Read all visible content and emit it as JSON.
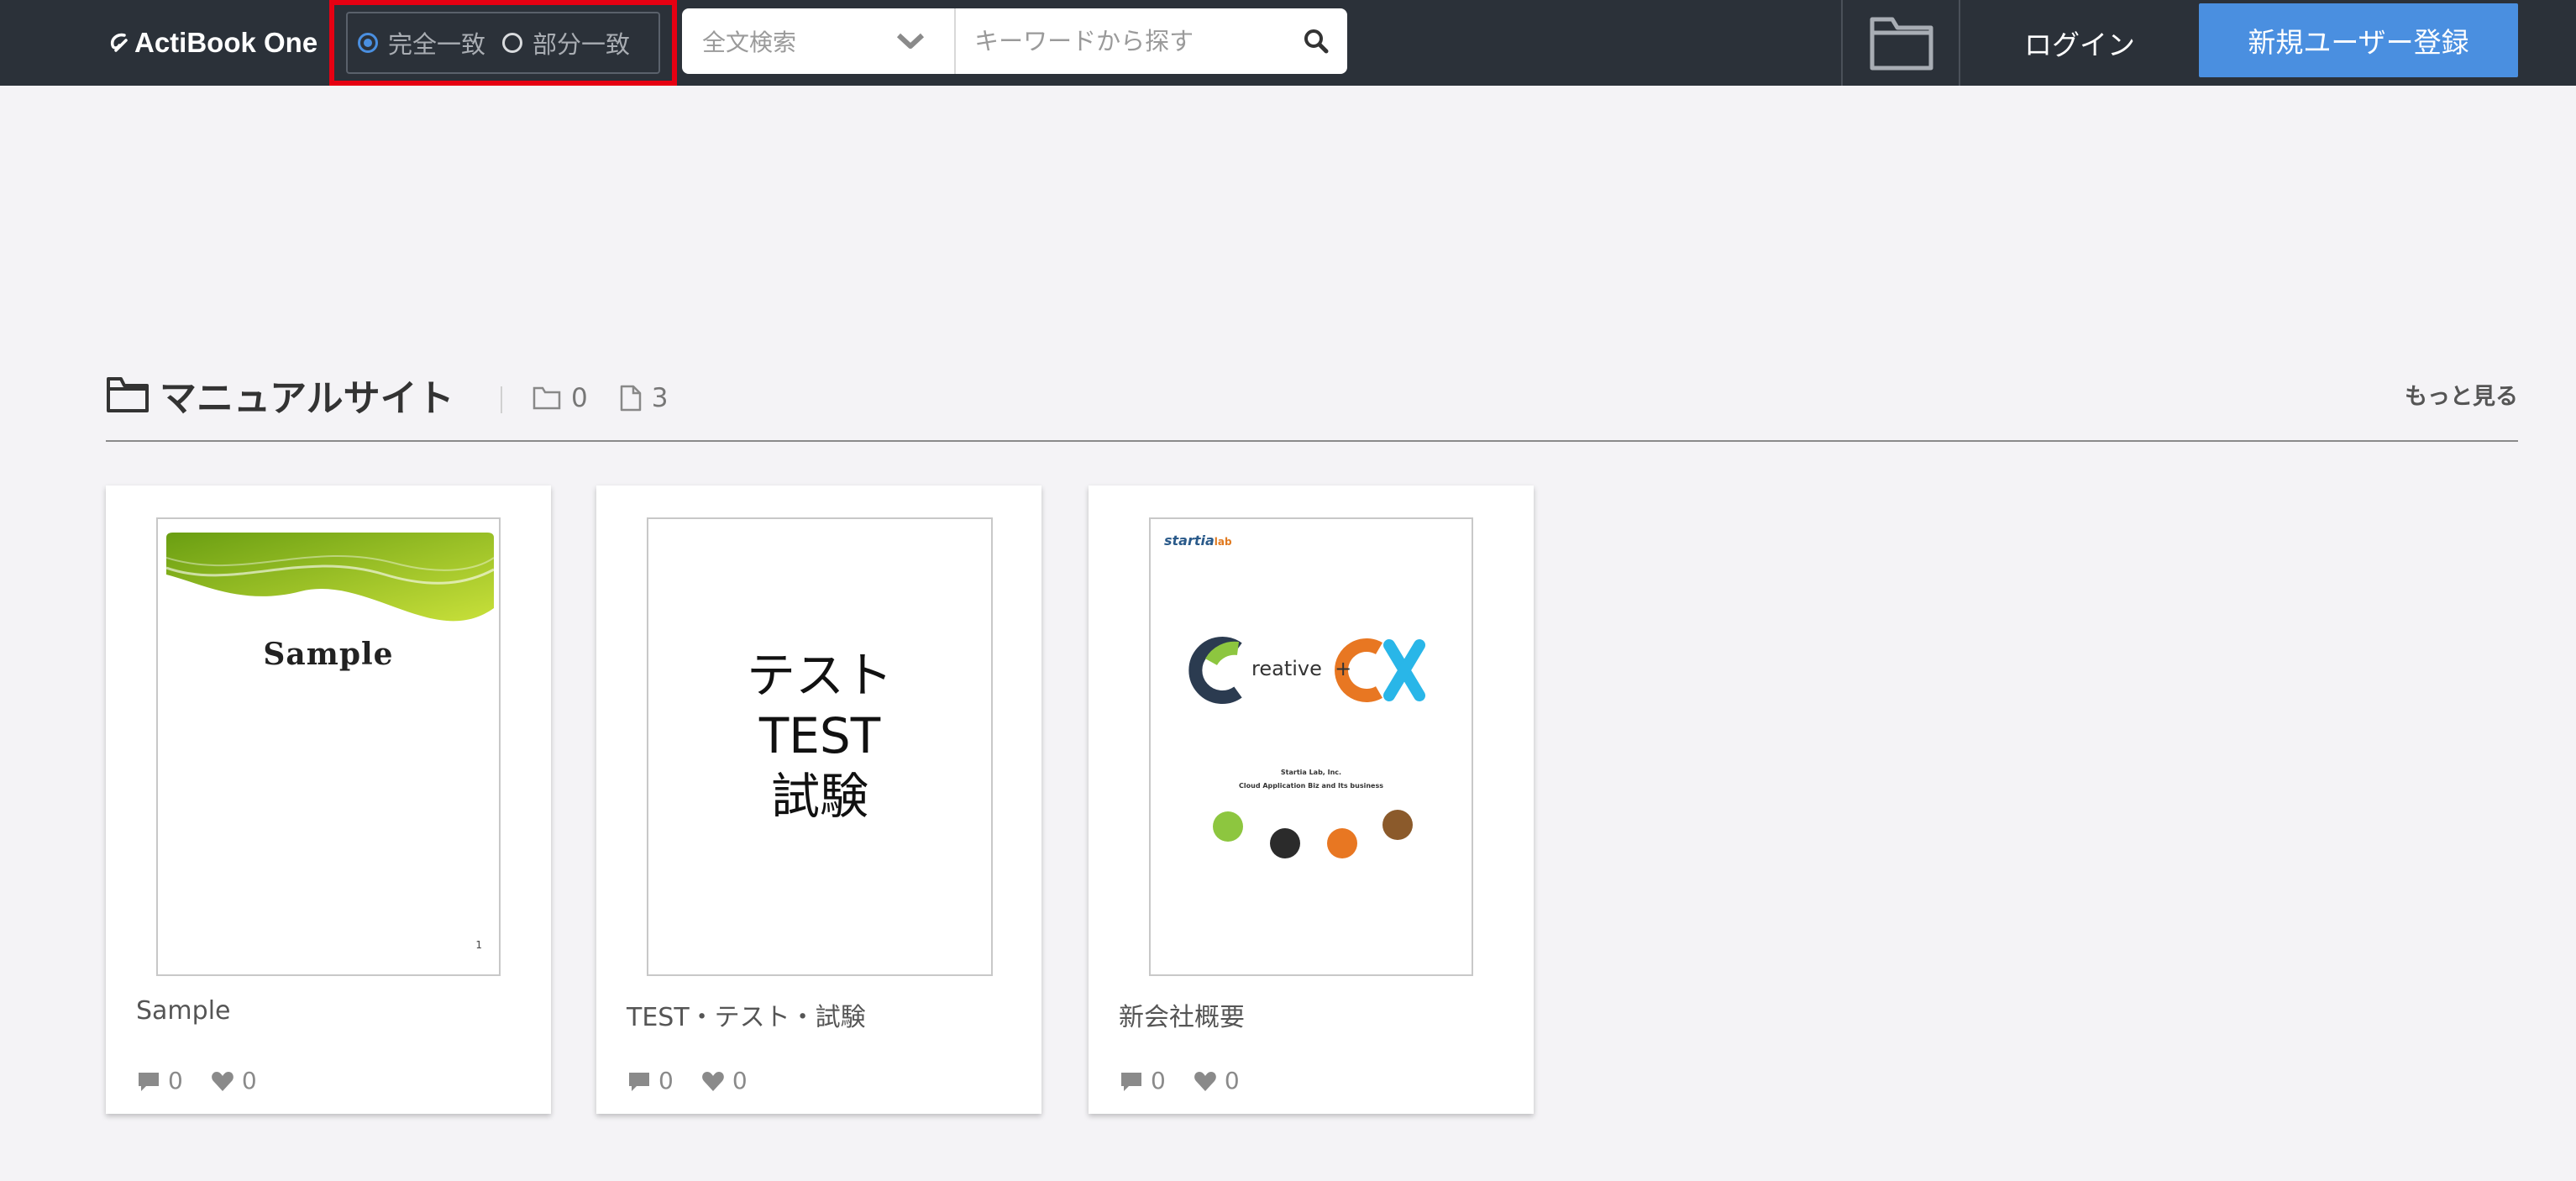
{
  "header": {
    "logo_text": "ActiBook One",
    "match_options": [
      {
        "label": "完全一致",
        "checked": true
      },
      {
        "label": "部分一致",
        "checked": false
      }
    ],
    "search_type": "全文検索",
    "search_placeholder": "キーワードから探す",
    "login_label": "ログイン",
    "register_label": "新規ユーザー登録"
  },
  "section": {
    "title": "マニュアルサイト",
    "folder_count": "0",
    "file_count": "3",
    "more_label": "もっと見る"
  },
  "cards": [
    {
      "title": "Sample",
      "comments": "0",
      "likes": "0",
      "thumb_title": "Sample",
      "thumb_page": "1"
    },
    {
      "title": "TEST・テスト・試験",
      "comments": "0",
      "likes": "0",
      "thumb_lines": [
        "テスト",
        "TEST",
        "試験"
      ]
    },
    {
      "title": "新会社概要",
      "comments": "0",
      "likes": "0",
      "thumb_brand": "startia",
      "thumb_brand_suffix": "lab",
      "thumb_reative": "reative",
      "thumb_plus": "+",
      "thumb_company": "Startia Lab, Inc.",
      "thumb_tagline": "Cloud Application Biz and Its business"
    }
  ],
  "colors": {
    "header_bg": "#2b3139",
    "accent_blue": "#4a8fe0",
    "highlight_red": "#e60012",
    "page_bg": "#f4f3f6"
  }
}
